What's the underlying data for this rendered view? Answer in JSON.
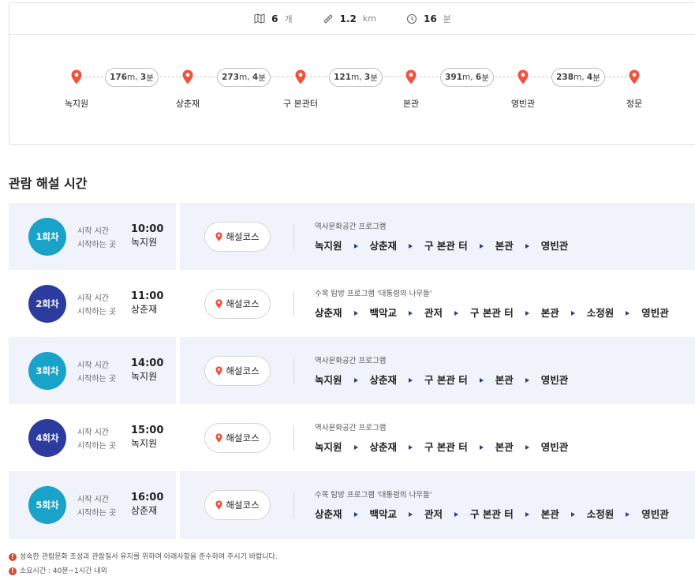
{
  "summary": {
    "stops_count": "6",
    "stops_unit": "개",
    "distance": "1.2",
    "distance_unit": "km",
    "duration": "16",
    "duration_unit": "분"
  },
  "route": {
    "stops": [
      "녹지원",
      "상춘재",
      "구 본관터",
      "본관",
      "영빈관",
      "정문"
    ],
    "segments": [
      {
        "dist": "176",
        "dist_unit": "m,",
        "time": "3",
        "time_unit": "분"
      },
      {
        "dist": "273",
        "dist_unit": "m,",
        "time": "4",
        "time_unit": "분"
      },
      {
        "dist": "121",
        "dist_unit": "m,",
        "time": "3",
        "time_unit": "분"
      },
      {
        "dist": "391",
        "dist_unit": "m,",
        "time": "6",
        "time_unit": "분"
      },
      {
        "dist": "238",
        "dist_unit": "m,",
        "time": "4",
        "time_unit": "분"
      }
    ]
  },
  "section_title": "관람 해설 시간",
  "labels": {
    "start_time": "시작 시간",
    "start_place": "시작하는 곳",
    "course_button": "해설코스"
  },
  "sessions": [
    {
      "badge": "1회차",
      "badge_color": "#1aa3c8",
      "time": "10:00",
      "place": "녹지원",
      "program": "역사문화공간 프로그램",
      "stops": [
        "녹지원",
        "상춘재",
        "구 본관 터",
        "본관",
        "영빈관"
      ]
    },
    {
      "badge": "2회차",
      "badge_color": "#2b3c9e",
      "time": "11:00",
      "place": "상춘재",
      "program": "수목 탐방 프로그램 '대통령의 나무들'",
      "stops": [
        "상춘재",
        "백악교",
        "관저",
        "구 본관 터",
        "본관",
        "소정원",
        "영빈관"
      ]
    },
    {
      "badge": "3회차",
      "badge_color": "#1aa3c8",
      "time": "14:00",
      "place": "녹지원",
      "program": "역사문화공간 프로그램",
      "stops": [
        "녹지원",
        "상춘재",
        "구 본관 터",
        "본관",
        "영빈관"
      ]
    },
    {
      "badge": "4회차",
      "badge_color": "#2b3c9e",
      "time": "15:00",
      "place": "녹지원",
      "program": "역사문화공간 프로그램",
      "stops": [
        "녹지원",
        "상춘재",
        "구 본관 터",
        "본관",
        "영빈관"
      ]
    },
    {
      "badge": "5회차",
      "badge_color": "#1aa3c8",
      "time": "16:00",
      "place": "상춘재",
      "program": "수목 탐방 프로그램 '대통령의 나무들'",
      "stops": [
        "상춘재",
        "백악교",
        "관저",
        "구 본관 터",
        "본관",
        "소정원",
        "영빈관"
      ]
    }
  ],
  "notes": [
    "성숙한 관람문화 조성과 관람질서 유지를 위하여 아래사항을 준수하여 주시기 바랍니다.",
    "소요시간 : 40분~1시간 내외"
  ],
  "colors": {
    "pin": "#f0523a",
    "arrow": "#2b3c8f",
    "alt_bg": "#f1f3fa"
  },
  "icons": {
    "stops": "map-icon",
    "distance": "ruler-icon",
    "duration": "clock-icon",
    "stop_pin": "location-pin-icon"
  }
}
